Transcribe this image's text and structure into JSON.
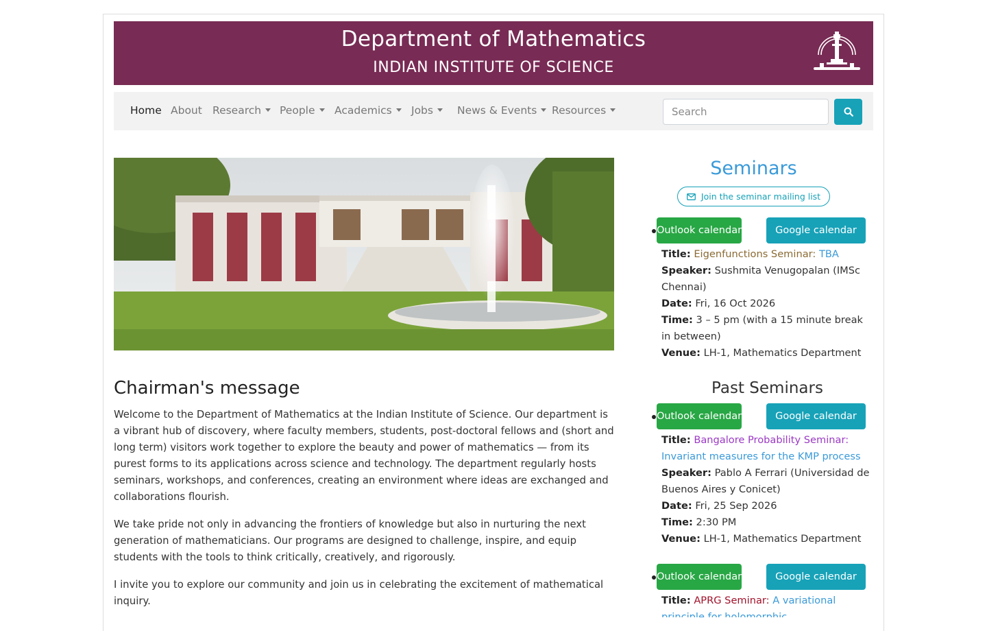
{
  "header": {
    "title": "Department of Mathematics",
    "subtitle": "INDIAN INSTITUTE OF SCIENCE"
  },
  "nav": {
    "items": [
      {
        "label": "Home",
        "dropdown": false,
        "active": true
      },
      {
        "label": "About",
        "dropdown": false
      },
      {
        "label": "Research",
        "dropdown": true
      },
      {
        "label": "People",
        "dropdown": true
      },
      {
        "label": "Academics",
        "dropdown": true
      },
      {
        "label": "Jobs",
        "dropdown": true
      },
      {
        "label": "News & Events",
        "dropdown": true
      },
      {
        "label": "Resources",
        "dropdown": true
      }
    ],
    "search_placeholder": "Search",
    "search_icon": "search-icon"
  },
  "chairman": {
    "heading": "Chairman's message",
    "paragraphs": [
      "Welcome to the Department of Mathematics at the Indian Institute of Science. Our department is a vibrant hub of discovery, where faculty members, students, post-doctoral fellows and (short and long term) visitors work together to explore the beauty and power of mathematics — from its purest forms to its applications across science and technology. The department regularly hosts seminars, workshops, and conferences, creating an environment where ideas are exchanged and collaborations flourish.",
      "We take pride not only in advancing the frontiers of knowledge but also in nurturing the next generation of mathematicians. Our programs are designed to challenge, inspire, and equip students with the tools to think critically, creatively, and rigorously.",
      "I invite you to explore our community and join us in celebrating the excitement of mathematical inquiry."
    ]
  },
  "seminars": {
    "heading": "Seminars",
    "mailing_label": "Join the seminar mailing list",
    "mailing_icon": "envelope-icon",
    "outlook_label": "Outlook calendar",
    "google_label": "Google calendar",
    "labels": {
      "title": "Title:",
      "speaker": "Speaker:",
      "date": "Date:",
      "time": "Time:",
      "venue": "Venue:"
    },
    "upcoming": [
      {
        "series": "Eigenfunctions Seminar:",
        "title": "TBA",
        "speaker": "Sushmita Venugopalan (IMSc Chennai)",
        "date": "Fri, 16 Oct 2026",
        "time": "3 – 5 pm (with a 15 minute break in between)",
        "venue": "LH-1, Mathematics Department"
      }
    ],
    "past_heading": "Past Seminars",
    "past": [
      {
        "series": "Bangalore Probability Seminar:",
        "title": "Invariant measures for the KMP process",
        "speaker": "Pablo A Ferrari (Universidad de Buenos Aires y Conicet)",
        "date": "Fri, 25 Sep 2026",
        "time": "2:30 PM",
        "venue": "LH-1, Mathematics Department"
      },
      {
        "series": "APRG Seminar:",
        "title": "A variational principle for holomorphic"
      }
    ]
  },
  "colors": {
    "banner": "#782b54",
    "nav_bg": "#f2f2f2",
    "accent": "#17a2b8",
    "outlook": "#28a745",
    "link": "#3a9ad9"
  }
}
